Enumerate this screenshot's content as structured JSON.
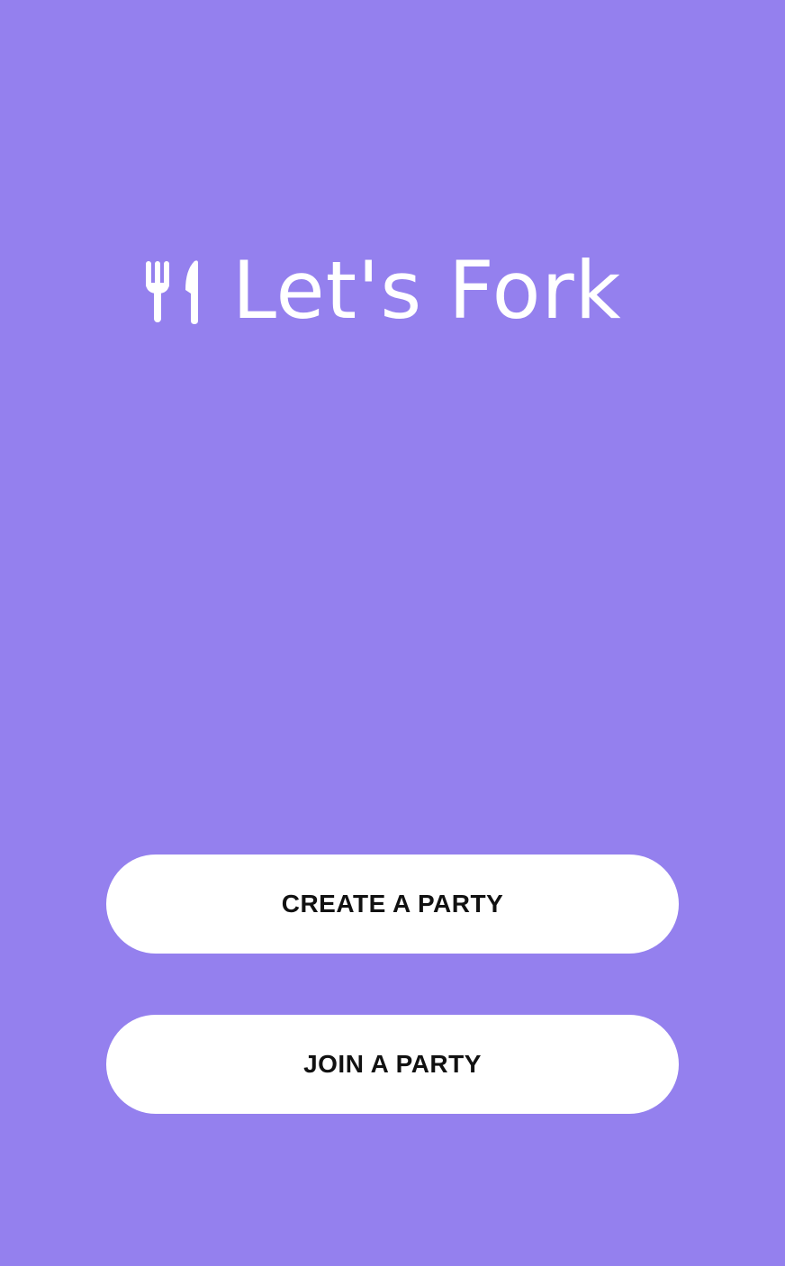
{
  "app": {
    "title": "Let's Fork",
    "logo_icon": "fork-knife-icon",
    "background_color": "#9480ee"
  },
  "actions": {
    "create_label": "CREATE A PARTY",
    "join_label": "JOIN A PARTY",
    "button_color": "#ffffff",
    "button_text_color": "#111111"
  }
}
